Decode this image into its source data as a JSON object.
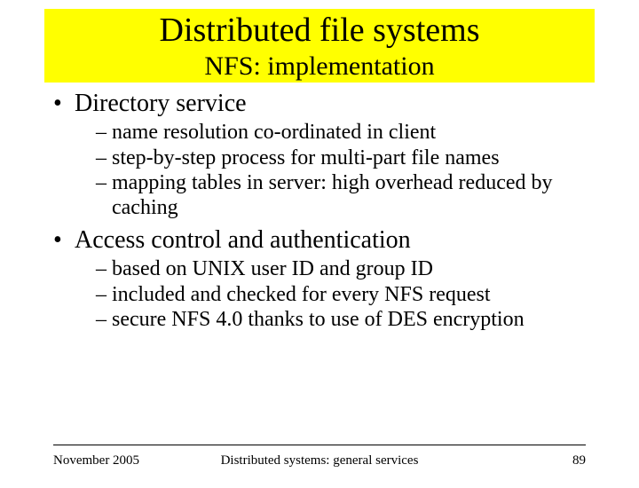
{
  "title": "Distributed file systems",
  "subtitle": "NFS: implementation",
  "bullets": [
    {
      "text": "Directory service",
      "subs": [
        "name resolution co-ordinated in client",
        "step-by-step process for multi-part file names",
        "mapping tables in server: high overhead reduced by caching"
      ]
    },
    {
      "text": "Access control and authentication",
      "subs": [
        "based on UNIX user ID and group ID",
        "included and checked for every NFS request",
        "secure NFS 4.0 thanks to use of DES encryption"
      ]
    }
  ],
  "footer": {
    "left": "November 2005",
    "center": "Distributed systems: general services",
    "right": "89"
  }
}
